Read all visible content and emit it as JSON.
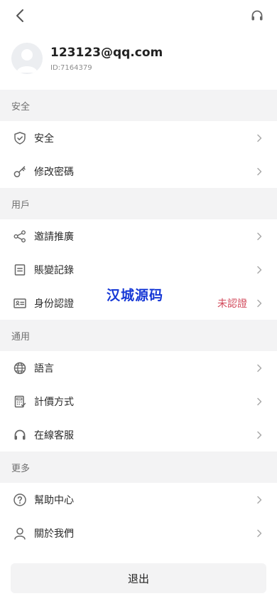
{
  "header": {
    "back_icon": "chevron-left-icon",
    "support_icon": "headset-icon"
  },
  "profile": {
    "email": "123123@qq.com",
    "user_id": "ID:7164379"
  },
  "sections": [
    {
      "title": "安全",
      "items": [
        {
          "label": "安全",
          "icon": "shield-icon"
        },
        {
          "label": "修改密碼",
          "icon": "key-icon"
        }
      ]
    },
    {
      "title": "用戶",
      "items": [
        {
          "label": "邀請推廣",
          "icon": "share-icon"
        },
        {
          "label": "賬變記錄",
          "icon": "document-icon"
        },
        {
          "label": "身份認證",
          "icon": "id-card-icon",
          "status": "未認證"
        }
      ]
    },
    {
      "title": "通用",
      "items": [
        {
          "label": "語言",
          "icon": "globe-icon"
        },
        {
          "label": "計價方式",
          "icon": "calculator-icon"
        },
        {
          "label": "在線客服",
          "icon": "headset-icon"
        }
      ]
    },
    {
      "title": "更多",
      "items": [
        {
          "label": "幫助中心",
          "icon": "question-icon"
        },
        {
          "label": "關於我們",
          "icon": "user-icon"
        }
      ]
    }
  ],
  "watermark": "汉城源码",
  "logout_label": "退出",
  "colors": {
    "section_background": "#f3f3f4",
    "status_unverified": "#d24a5b",
    "watermark": "#1638d6"
  }
}
